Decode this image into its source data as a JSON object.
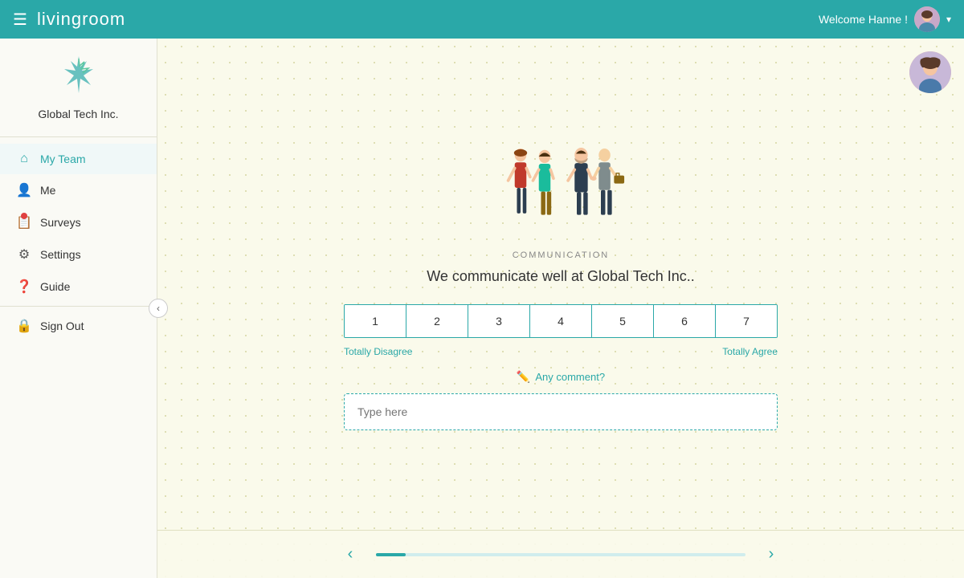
{
  "header": {
    "app_name": "livingroom",
    "menu_icon": "☰",
    "welcome_text": "Welcome Hanne !",
    "chevron": "▾"
  },
  "sidebar": {
    "company_name": "Global Tech Inc.",
    "logo_icon": "🪶",
    "collapse_icon": "‹",
    "nav_items": [
      {
        "id": "my-team",
        "label": "My Team",
        "icon": "⌂",
        "active": true,
        "badge": false
      },
      {
        "id": "me",
        "label": "Me",
        "icon": "👤",
        "active": false,
        "badge": false
      },
      {
        "id": "surveys",
        "label": "Surveys",
        "icon": "📋",
        "active": false,
        "badge": true
      },
      {
        "id": "settings",
        "label": "Settings",
        "icon": "⚙",
        "active": false,
        "badge": false
      },
      {
        "id": "guide",
        "label": "Guide",
        "icon": "❓",
        "active": false,
        "badge": false
      }
    ],
    "sign_out_label": "Sign Out",
    "lock_icon": "🔒"
  },
  "survey": {
    "category": "COMMUNICATION",
    "question": "We communicate well at Global Tech Inc..",
    "rating_options": [
      "1",
      "2",
      "3",
      "4",
      "5",
      "6",
      "7"
    ],
    "label_left": "Totally Disagree",
    "label_right": "Totally Agree",
    "comment_link": "Any comment?",
    "comment_placeholder": "Type here"
  },
  "progress": {
    "fill_width": "8%"
  }
}
